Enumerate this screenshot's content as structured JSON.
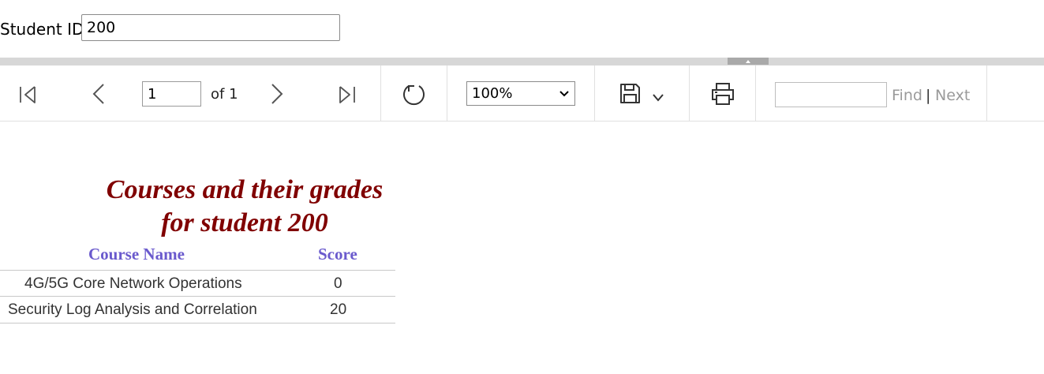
{
  "params": {
    "student_id_label": "Student ID",
    "student_id_value": "200"
  },
  "toolbar": {
    "page_current": "1",
    "page_of": "of 1",
    "zoom": "100%",
    "zoom_options": [
      "100%"
    ],
    "find_placeholder": "",
    "find_label": "Find",
    "separator": "|",
    "next_label": "Next",
    "icons": [
      "first-page-icon",
      "previous-page-icon",
      "next-page-icon",
      "last-page-icon",
      "refresh-icon",
      "save-icon",
      "chevron-down-icon",
      "print-icon"
    ]
  },
  "report": {
    "title_line1": "Courses and their grades",
    "title_line2": "for student 200",
    "columns": [
      "Course Name",
      "Score"
    ],
    "rows": [
      [
        "4G/5G Core Network Operations",
        "0"
      ],
      [
        "Security Log Analysis and Correlation",
        "20"
      ]
    ],
    "title_color": "#800000",
    "header_color": "#6a5acd"
  }
}
